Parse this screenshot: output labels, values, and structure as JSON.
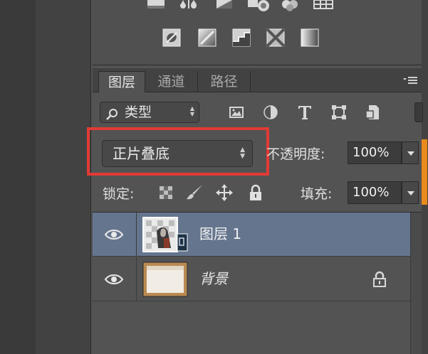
{
  "adjustments": {
    "row1_icons": [
      "levels-icon",
      "balance-icon",
      "black-white-icon",
      "photo-filter-icon",
      "channel-mixer-icon",
      "color-lookup-icon"
    ],
    "row2_icons": [
      "invert-icon",
      "posterize-icon",
      "threshold-icon",
      "selective-color-icon",
      "gradient-map-icon"
    ]
  },
  "layers_panel": {
    "tabs": [
      {
        "label": "图层",
        "active": true
      },
      {
        "label": "通道",
        "active": false
      },
      {
        "label": "路径",
        "active": false
      }
    ],
    "filter": {
      "label": "类型"
    },
    "filter_icons": [
      "image-filter-icon",
      "adjustment-filter-icon",
      "type-filter-icon",
      "shape-filter-icon",
      "smart-object-filter-icon"
    ],
    "blend_mode": "正片叠底",
    "opacity_label": "不透明度:",
    "opacity_value": "100%",
    "lock_label": "锁定:",
    "fill_label": "填充:",
    "fill_value": "100%",
    "layers": [
      {
        "name": "图层 1",
        "selected": true,
        "visible": true,
        "locked": false
      },
      {
        "name": "背景",
        "selected": false,
        "visible": true,
        "locked": true
      }
    ]
  },
  "colors": {
    "selection": "#65758e",
    "highlight_box": "#e23a35",
    "accent": "#e98a1d"
  }
}
